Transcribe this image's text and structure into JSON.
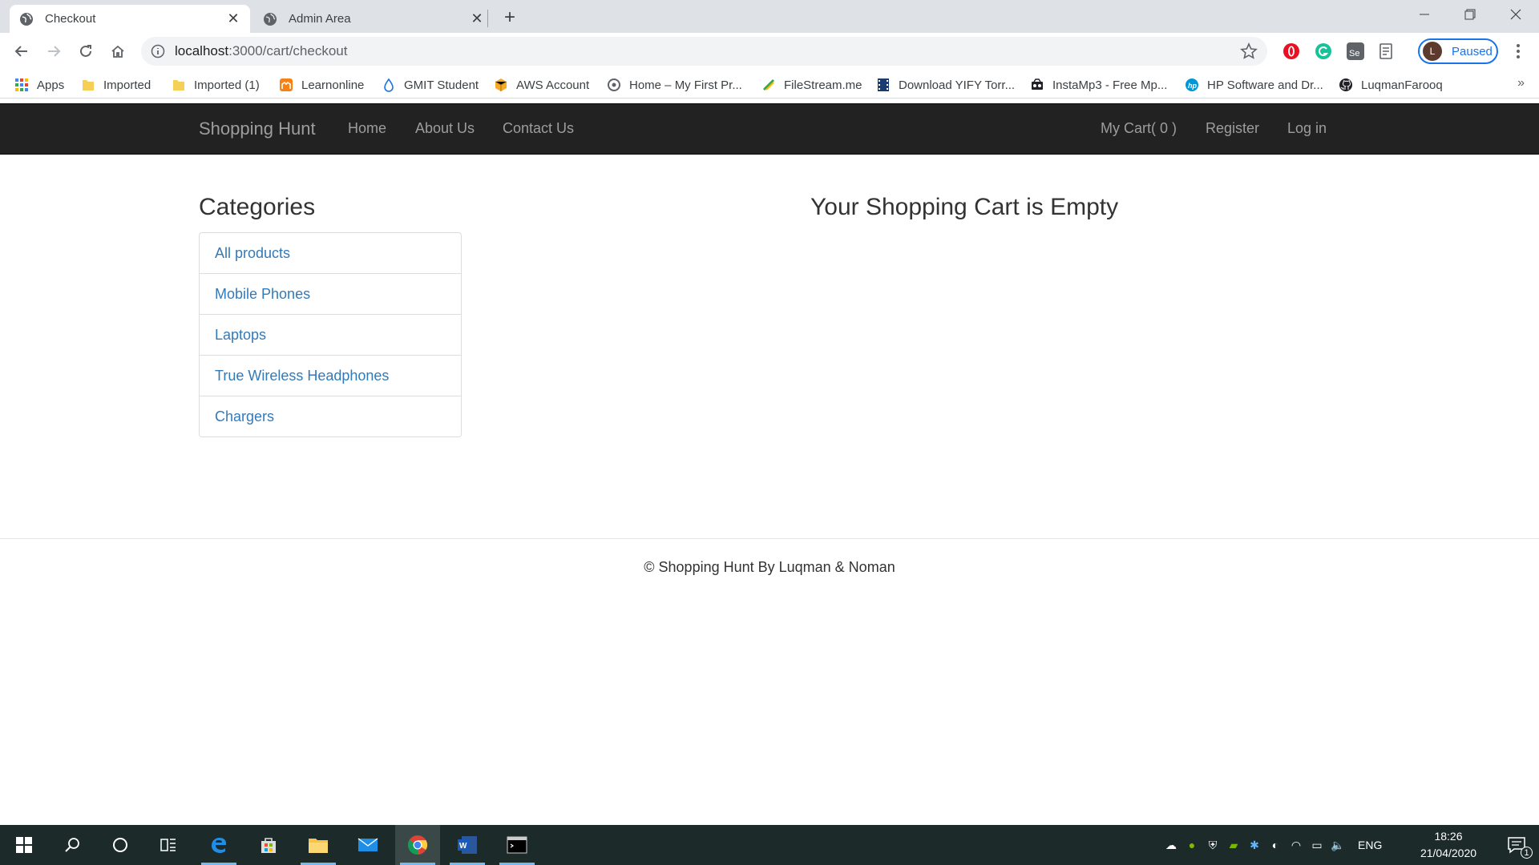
{
  "browser": {
    "tabs": [
      {
        "title": "Checkout",
        "active": true
      },
      {
        "title": "Admin Area",
        "active": false
      }
    ],
    "new_tab_label": "+",
    "address": {
      "host": "localhost",
      "path": ":3000/cart/checkout"
    },
    "profile": {
      "initial": "L",
      "status": "Paused"
    },
    "bookmarks": [
      {
        "label": "Apps",
        "icon": "apps-grid-icon"
      },
      {
        "label": "Imported",
        "icon": "folder-icon"
      },
      {
        "label": "Imported (1)",
        "icon": "folder-icon"
      },
      {
        "label": "Learnonline",
        "icon": "moodle-icon"
      },
      {
        "label": "GMIT Student",
        "icon": "gmit-icon"
      },
      {
        "label": "AWS Account",
        "icon": "aws-box-icon"
      },
      {
        "label": "Home – My First Pr...",
        "icon": "site-icon"
      },
      {
        "label": "FileStream.me",
        "icon": "filestream-icon"
      },
      {
        "label": "Download YIFY Torr...",
        "icon": "film-icon"
      },
      {
        "label": "InstaMp3 - Free Mp...",
        "icon": "instamp3-icon"
      },
      {
        "label": "HP Software and Dr...",
        "icon": "hp-icon"
      },
      {
        "label": "LuqmanFarooq",
        "icon": "github-icon"
      }
    ],
    "bookmarks_overflow": "»"
  },
  "navbar": {
    "brand": "Shopping Hunt",
    "links": [
      "Home",
      "About Us",
      "Contact Us"
    ],
    "right_links": [
      "My Cart( 0 )",
      "Register",
      "Log in"
    ]
  },
  "sidebar": {
    "title": "Categories",
    "items": [
      "All products",
      "Mobile Phones",
      "Laptops",
      "True Wireless Headphones",
      "Chargers"
    ]
  },
  "main": {
    "message": "Your Shopping Cart is Empty"
  },
  "footer": {
    "text": "© Shopping Hunt By Luqman & Noman"
  },
  "taskbar": {
    "language": "ENG",
    "time": "18:26",
    "date": "21/04/2020",
    "notification_count": "1"
  },
  "colors": {
    "navbar_bg": "#222222",
    "navbar_text": "#9d9d9d",
    "link": "#337ab7",
    "taskbar_bg": "#1c2a2a"
  }
}
